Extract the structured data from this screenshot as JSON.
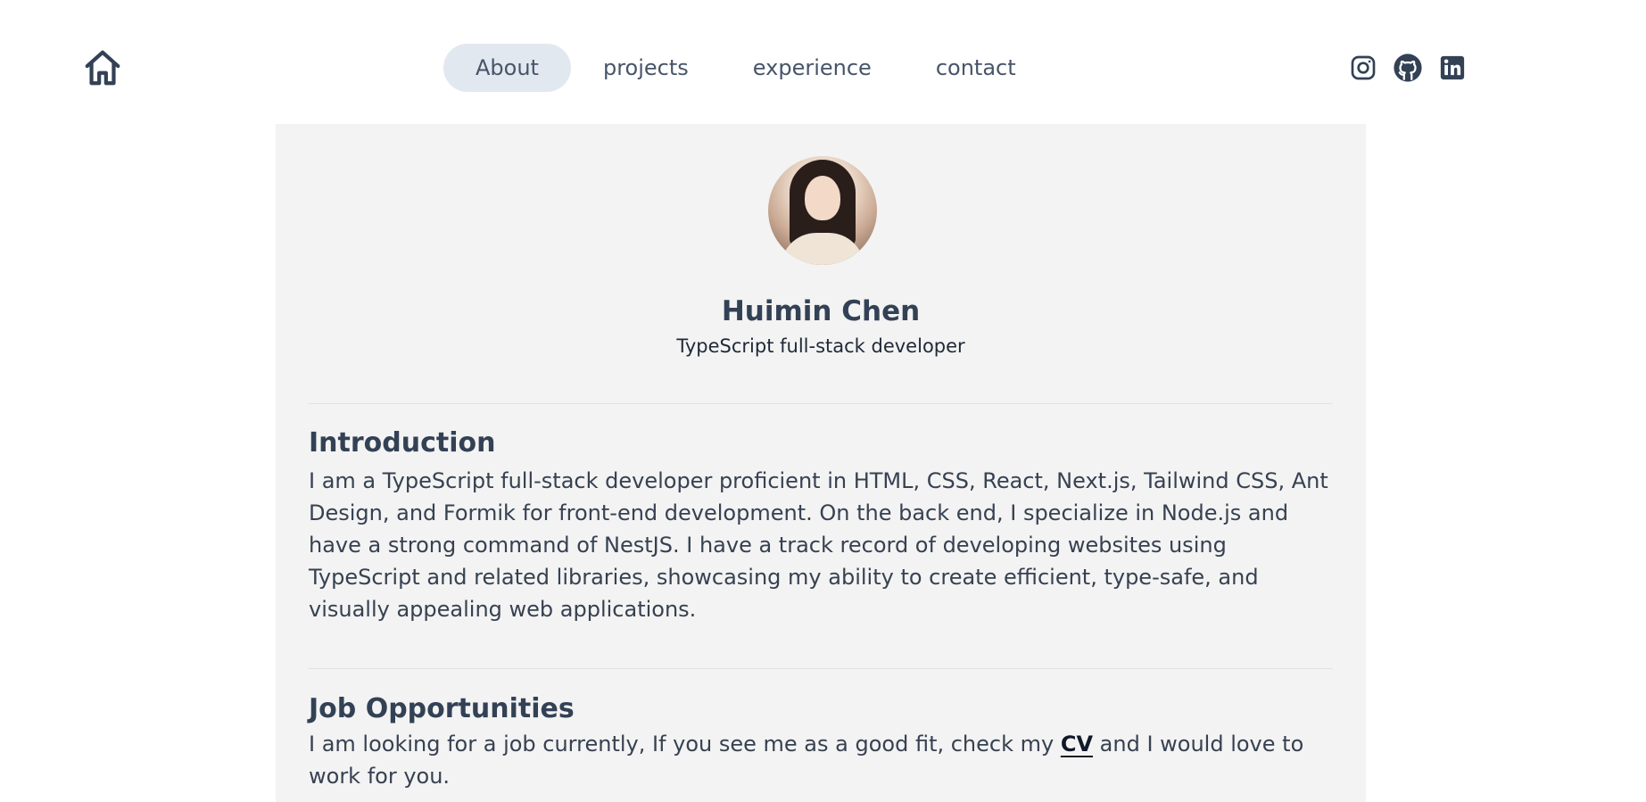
{
  "nav": {
    "home_icon": "home-icon",
    "items": [
      {
        "label": "About",
        "active": true
      },
      {
        "label": "projects",
        "active": false
      },
      {
        "label": "experience",
        "active": false
      },
      {
        "label": "contact",
        "active": false
      }
    ]
  },
  "socials": {
    "icons": [
      "instagram-icon",
      "github-icon",
      "linkedin-icon"
    ],
    "theme_icon": "moon-icon"
  },
  "profile": {
    "name": "Huimin Chen",
    "title": "TypeScript full-stack developer"
  },
  "introduction": {
    "heading": "Introduction",
    "body": "I am a TypeScript full-stack developer proficient in HTML, CSS, React, Next.js, Tailwind CSS, Ant Design, and Formik for front-end development. On the back end, I specialize in Node.js and have a strong command of NestJS. I have a track record of developing websites using TypeScript and related libraries, showcasing my ability to create efficient, type-safe, and visually appealing web applications."
  },
  "jobs": {
    "heading": "Job Opportunities",
    "body_before": "I am looking for a job currently, If you see me as a good fit, check my ",
    "cv_label": "CV",
    "body_after": " and I would love to work for you."
  },
  "colors": {
    "text": "#334155",
    "card_bg": "#f3f3f3",
    "nav_active_bg": "#e2e8f0"
  }
}
